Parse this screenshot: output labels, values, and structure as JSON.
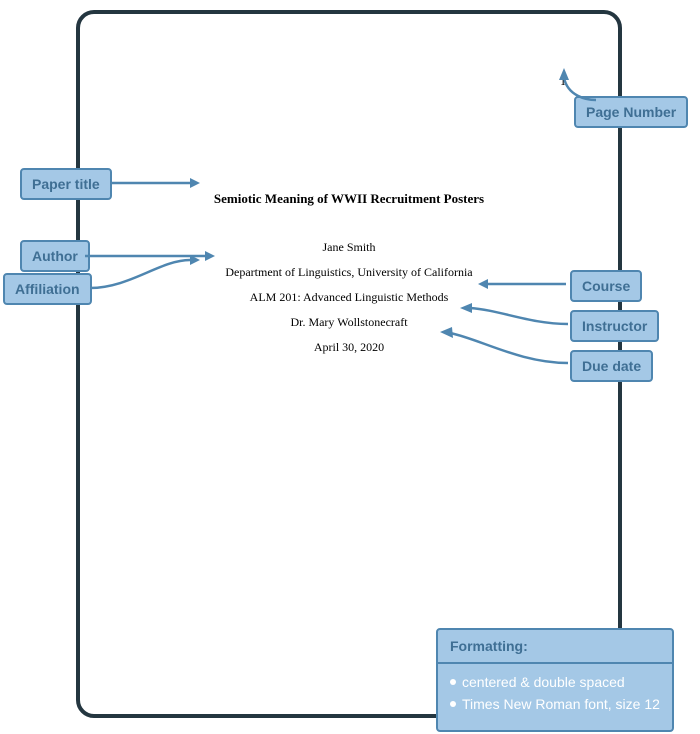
{
  "page": {
    "number": "1",
    "title": "Semiotic Meaning of WWII Recruitment Posters",
    "author": "Jane Smith",
    "affiliation": "Department of Linguistics, University of California",
    "course": "ALM 201: Advanced Linguistic Methods",
    "instructor": "Dr. Mary Wollstonecraft",
    "due_date": "April 30, 2020"
  },
  "labels": {
    "paper_title": "Paper title",
    "author": "Author",
    "affiliation": "Affiliation",
    "page_number": "Page Number",
    "course": "Course",
    "instructor": "Instructor",
    "due_date": "Due date"
  },
  "formatting": {
    "title": "Formatting:",
    "line1": "centered   &   double spaced",
    "line2": "Times New Roman font, size 12"
  }
}
